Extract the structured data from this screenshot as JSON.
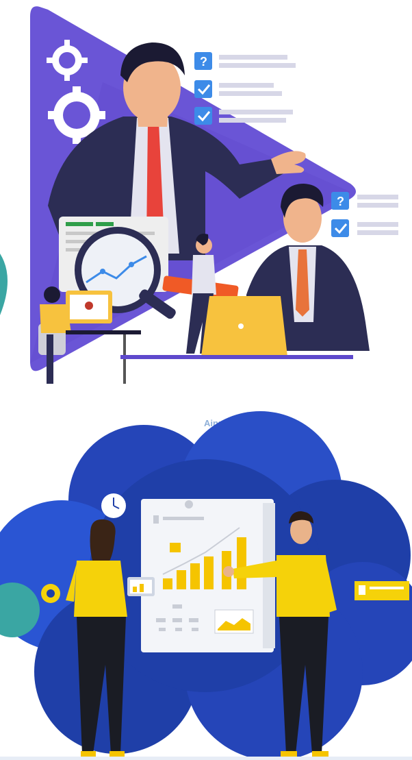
{
  "top_illustration": {
    "colors": {
      "triangle": "#6a55d6",
      "suit": "#2c2d54",
      "tie": "#e8433b",
      "skin": "#f0b48c",
      "check": "#3d8be8",
      "desk": "#f7c23e"
    },
    "icons": [
      "gear-icon",
      "question-icon",
      "checkbox-icon",
      "magnifier-icon",
      "laptop-icon"
    ]
  },
  "bottom_illustration": {
    "label": "Ainus",
    "colors": {
      "cloud_dark": "#1f3fa8",
      "cloud_light": "#2a55d3",
      "shirt": "#f5d20a",
      "board": "#f3f5f9",
      "bar": "#f5c400"
    },
    "bar_values": [
      0.2,
      0.35,
      0.5,
      0.65,
      0.85
    ]
  }
}
